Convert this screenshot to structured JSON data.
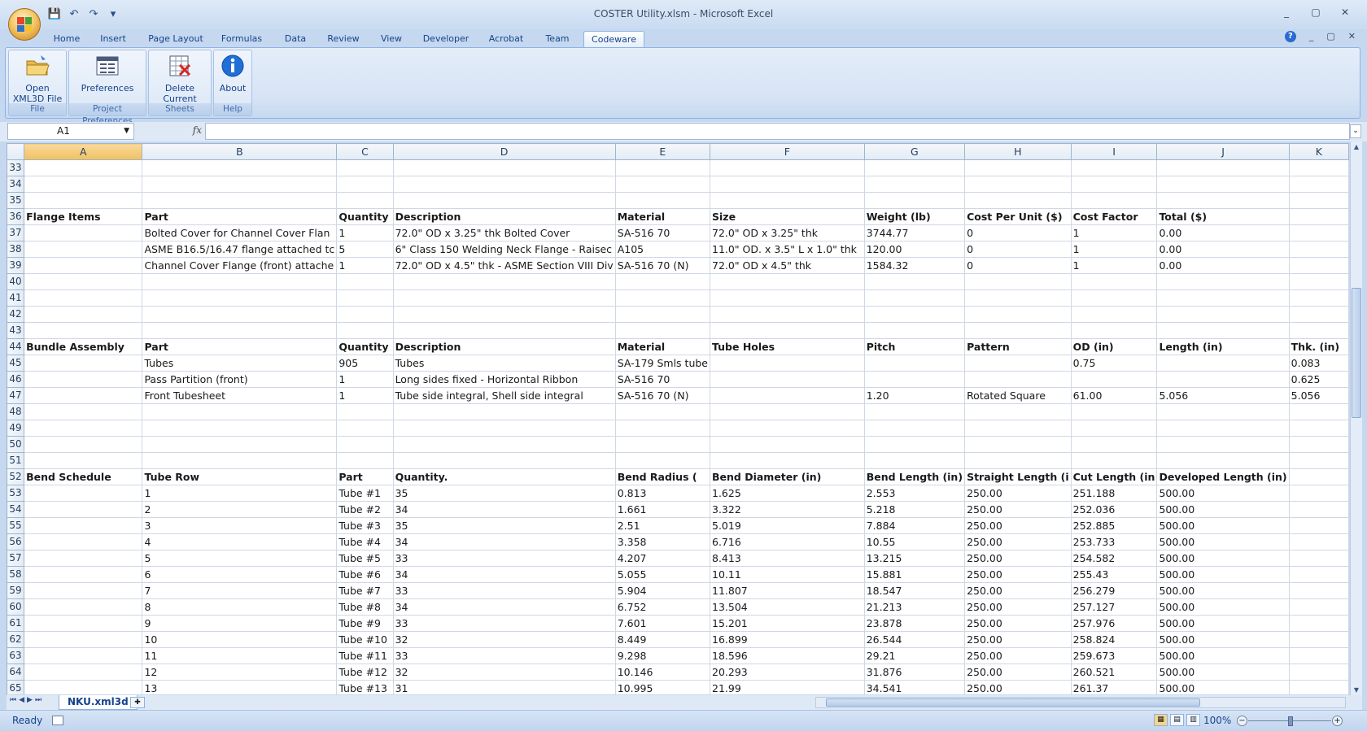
{
  "window": {
    "title": "COSTER Utility.xlsm - Microsoft Excel",
    "controls": [
      "_",
      "▢",
      "✕"
    ]
  },
  "qat": {
    "save": "💾",
    "undo": "↶",
    "redo": "↷",
    "customize": "▾"
  },
  "tabs": [
    "Home",
    "Insert",
    "Page Layout",
    "Formulas",
    "Data",
    "Review",
    "View",
    "Developer",
    "Acrobat",
    "Team",
    "Codeware"
  ],
  "active_tab": "Codeware",
  "ribbon": {
    "groups": [
      {
        "button": "Open\nXML3D File",
        "label": "File",
        "icon": "folder-icon"
      },
      {
        "button": "Preferences",
        "label": "Project Preferences",
        "icon": "preferences-icon"
      },
      {
        "button": "Delete\nCurrent Sheet",
        "label": "Sheets",
        "icon": "delete-sheet-icon"
      },
      {
        "button": "About",
        "label": "Help",
        "icon": "info-icon"
      }
    ]
  },
  "formula_bar": {
    "name_box": "A1",
    "fx": "fx",
    "value": ""
  },
  "columns": [
    "A",
    "B",
    "C",
    "D",
    "E",
    "F",
    "G",
    "H",
    "I",
    "J",
    "K"
  ],
  "selected_column": "A",
  "rows": [
    {
      "n": "33",
      "cells": [
        "",
        "",
        "",
        "",
        "",
        "",
        "",
        "",
        "",
        "",
        ""
      ]
    },
    {
      "n": "34",
      "cells": [
        "",
        "",
        "",
        "",
        "",
        "",
        "",
        "",
        "",
        "",
        ""
      ]
    },
    {
      "n": "35",
      "cells": [
        "",
        "",
        "",
        "",
        "",
        "",
        "",
        "",
        "",
        "",
        ""
      ]
    },
    {
      "n": "36",
      "bold": true,
      "cells": [
        "Flange Items",
        "Part",
        "Quantity",
        "Description",
        "Material",
        "Size",
        "Weight (lb)",
        "Cost Per Unit ($)",
        "Cost Factor",
        "Total ($)",
        ""
      ]
    },
    {
      "n": "37",
      "cells": [
        "",
        "Bolted Cover for Channel Cover Flan",
        "1",
        "72.0\" OD x 3.25\" thk  Bolted Cover",
        "SA-516 70",
        "72.0\" OD x 3.25\" thk",
        "3744.77",
        "0",
        "1",
        "0.00",
        ""
      ]
    },
    {
      "n": "38",
      "cells": [
        "",
        "ASME B16.5/16.47 flange attached tc",
        "5",
        "6\" Class 150 Welding Neck  Flange - Raisec",
        "A105",
        "11.0\" OD. x 3.5\" L x 1.0\" thk",
        "120.00",
        "0",
        "1",
        "0.00",
        ""
      ]
    },
    {
      "n": "39",
      "cells": [
        "",
        "Channel Cover Flange (front) attache",
        "1",
        "72.0\" OD x 4.5\" thk  - ASME Section VIII Div",
        "SA-516 70 (N)",
        "72.0\" OD x 4.5\" thk",
        "1584.32",
        "0",
        "1",
        "0.00",
        ""
      ]
    },
    {
      "n": "40",
      "cells": [
        "",
        "",
        "",
        "",
        "",
        "",
        "",
        "",
        "",
        "",
        ""
      ]
    },
    {
      "n": "41",
      "cells": [
        "",
        "",
        "",
        "",
        "",
        "",
        "",
        "",
        "",
        "",
        ""
      ]
    },
    {
      "n": "42",
      "cells": [
        "",
        "",
        "",
        "",
        "",
        "",
        "",
        "",
        "",
        "",
        ""
      ]
    },
    {
      "n": "43",
      "cells": [
        "",
        "",
        "",
        "",
        "",
        "",
        "",
        "",
        "",
        "",
        ""
      ]
    },
    {
      "n": "44",
      "bold": true,
      "cells": [
        "Bundle Assembly",
        "Part",
        "Quantity",
        "Description",
        "Material",
        "Tube Holes",
        "Pitch",
        "Pattern",
        "OD (in)",
        "Length (in)",
        "Thk. (in)"
      ]
    },
    {
      "n": "45",
      "cells": [
        "",
        "Tubes",
        "905",
        "Tubes",
        "SA-179 Smls tube",
        "",
        "",
        "",
        "0.75",
        "",
        "0.083"
      ]
    },
    {
      "n": "46",
      "cells": [
        "",
        "Pass Partition (front)",
        "1",
        "Long sides fixed - Horizontal Ribbon",
        "SA-516 70",
        "",
        "",
        "",
        "",
        "",
        "0.625"
      ]
    },
    {
      "n": "47",
      "cells": [
        "",
        "Front Tubesheet",
        "1",
        "Tube side integral, Shell side integral",
        "SA-516 70 (N)",
        "",
        "1.20",
        "Rotated Square",
        "61.00",
        "5.056",
        "5.056"
      ]
    },
    {
      "n": "48",
      "cells": [
        "",
        "",
        "",
        "",
        "",
        "",
        "",
        "",
        "",
        "",
        ""
      ]
    },
    {
      "n": "49",
      "cells": [
        "",
        "",
        "",
        "",
        "",
        "",
        "",
        "",
        "",
        "",
        ""
      ]
    },
    {
      "n": "50",
      "cells": [
        "",
        "",
        "",
        "",
        "",
        "",
        "",
        "",
        "",
        "",
        ""
      ]
    },
    {
      "n": "51",
      "cells": [
        "",
        "",
        "",
        "",
        "",
        "",
        "",
        "",
        "",
        "",
        ""
      ]
    },
    {
      "n": "52",
      "bold": true,
      "cells": [
        "Bend Schedule",
        "Tube Row",
        "Part",
        "Quantity.",
        "Bend Radius (",
        "Bend Diameter (in)",
        "Bend Length (in)",
        "Straight Length (i",
        "Cut Length (in",
        "Developed Length (in)",
        ""
      ]
    },
    {
      "n": "53",
      "cells": [
        "",
        "1",
        "Tube #1",
        "35",
        "0.813",
        "1.625",
        "2.553",
        "250.00",
        "251.188",
        "500.00",
        ""
      ]
    },
    {
      "n": "54",
      "cells": [
        "",
        "2",
        "Tube #2",
        "34",
        "1.661",
        "3.322",
        "5.218",
        "250.00",
        "252.036",
        "500.00",
        ""
      ]
    },
    {
      "n": "55",
      "cells": [
        "",
        "3",
        "Tube #3",
        "35",
        "2.51",
        "5.019",
        "7.884",
        "250.00",
        "252.885",
        "500.00",
        ""
      ]
    },
    {
      "n": "56",
      "cells": [
        "",
        "4",
        "Tube #4",
        "34",
        "3.358",
        "6.716",
        "10.55",
        "250.00",
        "253.733",
        "500.00",
        ""
      ]
    },
    {
      "n": "57",
      "cells": [
        "",
        "5",
        "Tube #5",
        "33",
        "4.207",
        "8.413",
        "13.215",
        "250.00",
        "254.582",
        "500.00",
        ""
      ]
    },
    {
      "n": "58",
      "cells": [
        "",
        "6",
        "Tube #6",
        "34",
        "5.055",
        "10.11",
        "15.881",
        "250.00",
        "255.43",
        "500.00",
        ""
      ]
    },
    {
      "n": "59",
      "cells": [
        "",
        "7",
        "Tube #7",
        "33",
        "5.904",
        "11.807",
        "18.547",
        "250.00",
        "256.279",
        "500.00",
        ""
      ]
    },
    {
      "n": "60",
      "cells": [
        "",
        "8",
        "Tube #8",
        "34",
        "6.752",
        "13.504",
        "21.213",
        "250.00",
        "257.127",
        "500.00",
        ""
      ]
    },
    {
      "n": "61",
      "cells": [
        "",
        "9",
        "Tube #9",
        "33",
        "7.601",
        "15.201",
        "23.878",
        "250.00",
        "257.976",
        "500.00",
        ""
      ]
    },
    {
      "n": "62",
      "cells": [
        "",
        "10",
        "Tube #10",
        "32",
        "8.449",
        "16.899",
        "26.544",
        "250.00",
        "258.824",
        "500.00",
        ""
      ]
    },
    {
      "n": "63",
      "cells": [
        "",
        "11",
        "Tube #11",
        "33",
        "9.298",
        "18.596",
        "29.21",
        "250.00",
        "259.673",
        "500.00",
        ""
      ]
    },
    {
      "n": "64",
      "cells": [
        "",
        "12",
        "Tube #12",
        "32",
        "10.146",
        "20.293",
        "31.876",
        "250.00",
        "260.521",
        "500.00",
        ""
      ]
    },
    {
      "n": "65",
      "cells": [
        "",
        "13",
        "Tube #13",
        "31",
        "10.995",
        "21.99",
        "34.541",
        "250.00",
        "261.37",
        "500.00",
        ""
      ]
    }
  ],
  "sheet_tab": "NKU.xml3d",
  "status": {
    "text": "Ready",
    "zoom": "100%"
  }
}
